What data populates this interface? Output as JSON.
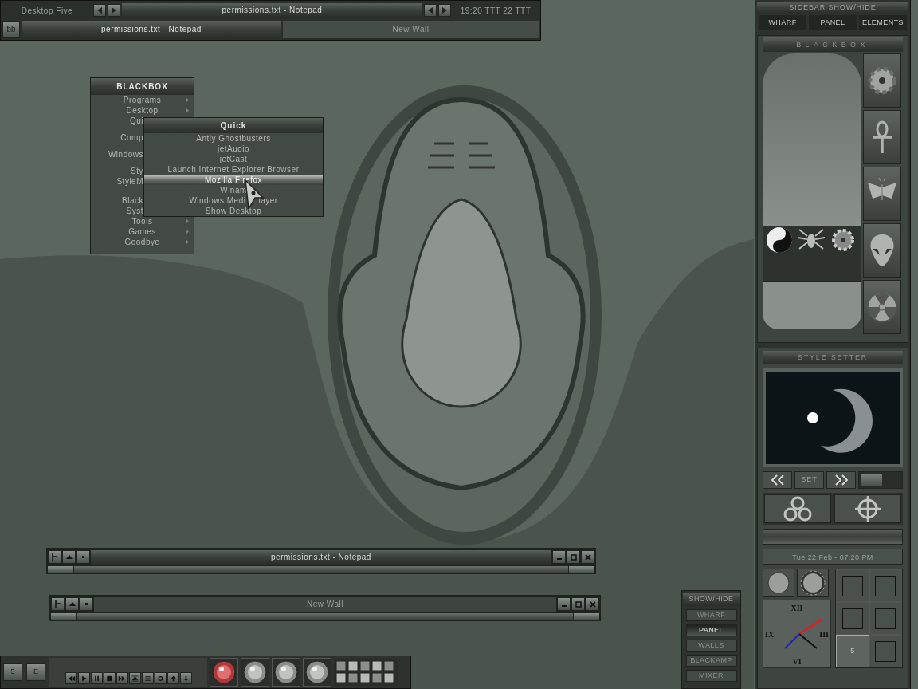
{
  "toolbar": {
    "workspace": "Desktop Five",
    "window_title": "permissions.txt - Notepad",
    "clock": "19:20 TTT 22 TTT",
    "menu_button": "bb",
    "tasks": [
      {
        "label": "permissions.txt - Notepad",
        "selected": true
      },
      {
        "label": "New Wall",
        "selected": false
      }
    ]
  },
  "root_menu": {
    "title": "BLACKBOX",
    "items": [
      {
        "kind": "full",
        "label": "Programs",
        "arrow": true
      },
      {
        "kind": "full",
        "label": "Desktop",
        "arrow": true
      },
      {
        "kind": "cut",
        "label": "Qui",
        "arrow": false
      },
      {
        "kind": "separator"
      },
      {
        "kind": "cut",
        "label": "Comp",
        "arrow": false
      },
      {
        "kind": "separator"
      },
      {
        "kind": "cut",
        "label": "Windows",
        "arrow": false
      },
      {
        "kind": "separator"
      },
      {
        "kind": "cut",
        "label": "Sty",
        "arrow": false
      },
      {
        "kind": "cut",
        "label": "StyleM",
        "arrow": false
      },
      {
        "kind": "separator"
      },
      {
        "kind": "cut",
        "label": "Black",
        "arrow": false
      },
      {
        "kind": "cut",
        "label": "Syst",
        "arrow": false
      },
      {
        "kind": "full",
        "label": "Tools",
        "arrow": true
      },
      {
        "kind": "full",
        "label": "Games",
        "arrow": true
      },
      {
        "kind": "full",
        "label": "Goodbye",
        "arrow": true
      }
    ]
  },
  "quick_menu": {
    "title": "Quick",
    "items": [
      {
        "label": "Antiy Ghostbusters",
        "selected": false
      },
      {
        "label": "jetAudio",
        "selected": false
      },
      {
        "label": "jetCast",
        "selected": false
      },
      {
        "label": "Launch Internet Explorer Browser",
        "selected": false
      },
      {
        "label": "Mozilla Firefox",
        "selected": true
      },
      {
        "label": "Winam",
        "selected": false
      },
      {
        "label": "Windows Medi",
        "tail": "layer",
        "selected": false
      },
      {
        "label": "Show Desktop",
        "selected": false
      }
    ]
  },
  "windows": [
    {
      "title": "permissions.txt - Notepad",
      "selected": true
    },
    {
      "title": "New Wall",
      "selected": false
    }
  ],
  "slit": {
    "buttons": [
      "5",
      "E"
    ]
  },
  "sidebar": {
    "header": "SIDEBAR SHOW/HIDE",
    "tabs": [
      {
        "label": "WHARF",
        "selected": false
      },
      {
        "label": "PANEL",
        "selected": false
      },
      {
        "label": "ELEMENTS",
        "selected": false
      }
    ],
    "blackbox_title": "BLACKBOX",
    "style_setter_title": "STYLE SETTER",
    "set_button": "SET",
    "slider": {
      "level": 0.55
    },
    "date": "Tue 22 Feb - 07:20 PM",
    "clock_numerals": [
      "XII",
      "III",
      "VI",
      "IX"
    ],
    "pager_label": "5"
  },
  "mini_panel": {
    "title": "SHOW/HIDE",
    "items": [
      {
        "label": "WHARF",
        "selected": false
      },
      {
        "label": "PANEL",
        "selected": true
      },
      {
        "label": "WALLS",
        "selected": false
      },
      {
        "label": "BLACKAMP",
        "selected": false
      },
      {
        "label": "MIXER",
        "selected": false
      }
    ]
  }
}
